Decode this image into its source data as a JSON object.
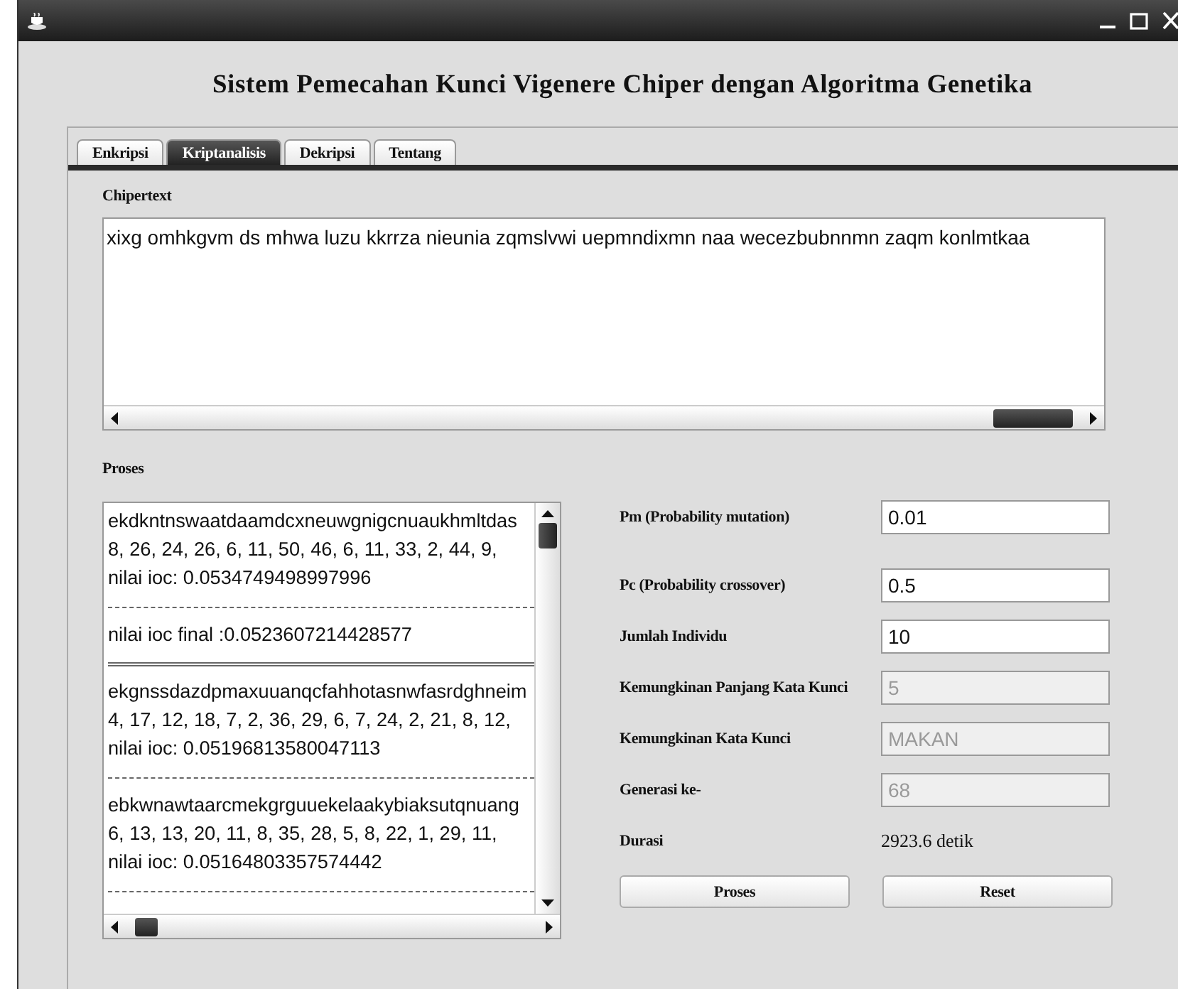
{
  "window": {
    "title": "Sistem Pemecahan Kunci Vigenere Chiper dengan Algoritma Genetika"
  },
  "tabs": [
    {
      "label": "Enkripsi",
      "selected": false
    },
    {
      "label": "Kriptanalisis",
      "selected": true
    },
    {
      "label": "Dekripsi",
      "selected": false
    },
    {
      "label": "Tentang",
      "selected": false
    }
  ],
  "chipertext": {
    "label": "Chipertext",
    "value": "xixg omhkgvm ds mhwa luzu kkrrza nieunia zqmslvwi uepmndixmn naa wecezbubnnmn zaqm konlmtkaa"
  },
  "proses": {
    "label": "Proses",
    "lines": [
      {
        "kind": "text",
        "text": "ekdkntnswaatdaamdcxneuwgnigcnuaukhmltdas"
      },
      {
        "kind": "text",
        "text": "8, 26, 24, 26, 6, 11, 50, 46, 6, 11, 33, 2, 44, 9,"
      },
      {
        "kind": "text",
        "text": "nilai ioc: 0.0534749498997996"
      },
      {
        "kind": "rule"
      },
      {
        "kind": "text",
        "text": "nilai ioc final :0.0523607214428577"
      },
      {
        "kind": "double-rule"
      },
      {
        "kind": "text",
        "text": "ekgnssdazdpmaxuuanqcfahhotasnwfasrdghneim"
      },
      {
        "kind": "text",
        "text": "4, 17, 12, 18, 7, 2, 36, 29, 6, 7, 24, 2, 21, 8, 12,"
      },
      {
        "kind": "text",
        "text": "nilai ioc: 0.05196813580047113"
      },
      {
        "kind": "rule"
      },
      {
        "kind": "text",
        "text": "ebkwnawtaarcmekgrguuekelaakybiaksutqnuang"
      },
      {
        "kind": "text",
        "text": "6, 13, 13, 20, 11, 8, 35, 28, 5, 8, 22, 1, 29, 11,"
      },
      {
        "kind": "text",
        "text": "nilai ioc: 0.05164803357574442"
      },
      {
        "kind": "rule"
      }
    ]
  },
  "form": [
    {
      "kind": "field",
      "label": "Pm (Probability mutation)",
      "value": "0.01",
      "disabled": false
    },
    {
      "kind": "field",
      "label": "Pc (Probability crossover)",
      "value": "0.5",
      "disabled": false
    },
    {
      "kind": "field",
      "label": "Jumlah Individu",
      "value": "10",
      "disabled": false
    },
    {
      "kind": "field",
      "label": "Kemungkinan Panjang Kata Kunci",
      "value": "5",
      "disabled": true
    },
    {
      "kind": "field",
      "label": "Kemungkinan Kata Kunci",
      "value": "MAKAN",
      "disabled": true
    },
    {
      "kind": "field",
      "label": "Generasi ke-",
      "value": "68",
      "disabled": true
    },
    {
      "kind": "text",
      "label": "Durasi",
      "value": "2923.6 detik"
    }
  ],
  "buttons": [
    "Proses",
    "Reset"
  ]
}
